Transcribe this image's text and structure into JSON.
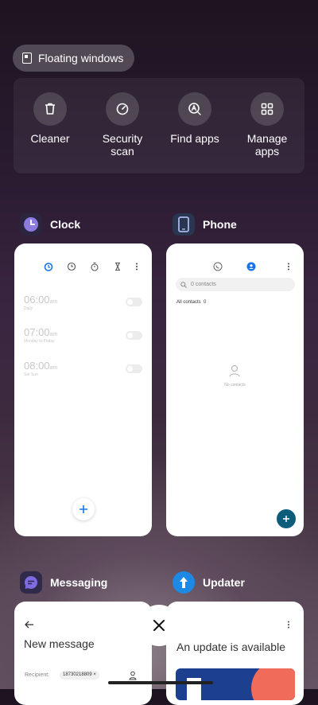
{
  "floating": {
    "label": "Floating windows"
  },
  "quick_actions": [
    {
      "label": "Cleaner",
      "icon": "trash-icon"
    },
    {
      "label": "Security scan",
      "icon": "gauge-icon"
    },
    {
      "label": "Find apps",
      "icon": "search-app-icon"
    },
    {
      "label": "Manage apps",
      "icon": "grid-icon"
    }
  ],
  "apps": {
    "clock": {
      "name": "Clock",
      "alarms": [
        {
          "time": "06:00",
          "ampm": "am",
          "repeat": "Daily"
        },
        {
          "time": "07:00",
          "ampm": "am",
          "repeat": "Monday to Friday"
        },
        {
          "time": "08:00",
          "ampm": "am",
          "repeat": "Sat Sun"
        }
      ]
    },
    "phone": {
      "name": "Phone",
      "search_placeholder": "0 contacts",
      "all_contacts": "All contacts",
      "count": "0",
      "empty": "No contacts"
    },
    "messaging": {
      "name": "Messaging",
      "title": "New message",
      "recipient_label": "Recipient:",
      "recipient_value": "18730218809"
    },
    "updater": {
      "name": "Updater",
      "title": "An update is available"
    }
  },
  "colors": {
    "accent": "#1a73e8",
    "clock_icon": "#8e7be0",
    "phone_icon": "#3b5ba8",
    "messaging_icon": "#6d5bd0",
    "updater_icon": "#1e88e5",
    "phone_fab": "#0d5c7a"
  }
}
